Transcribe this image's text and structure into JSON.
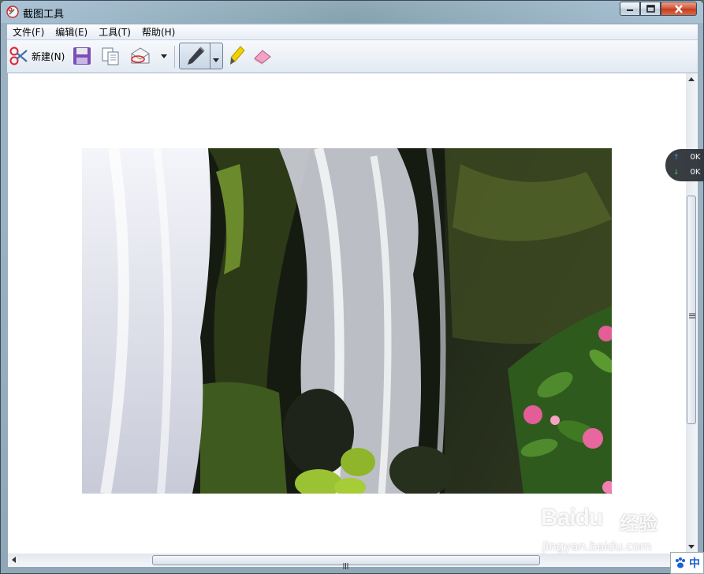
{
  "window": {
    "title": "截图工具",
    "controls": {
      "minimize": "minimize",
      "maximize": "maximize",
      "close": "close"
    }
  },
  "menu": [
    {
      "label": "文件(F)"
    },
    {
      "label": "编辑(E)"
    },
    {
      "label": "工具(T)"
    },
    {
      "label": "帮助(H)"
    }
  ],
  "toolbar": {
    "new_label": "新建(N)",
    "icons": [
      "scissors-icon",
      "save-icon",
      "copy-icon",
      "send-email-icon",
      "dropdown-arrow-icon",
      "pen-icon",
      "highlighter-icon",
      "eraser-icon"
    ]
  },
  "canvas": {
    "image_description": "waterfall with moss-covered rocks and pink flowers"
  },
  "net_speed": {
    "up": "0K",
    "down": "0K"
  },
  "watermark": {
    "brand": "Baidu",
    "sub": "经验",
    "url": "jingyan.baidu.com"
  },
  "ime": {
    "label": "中"
  }
}
